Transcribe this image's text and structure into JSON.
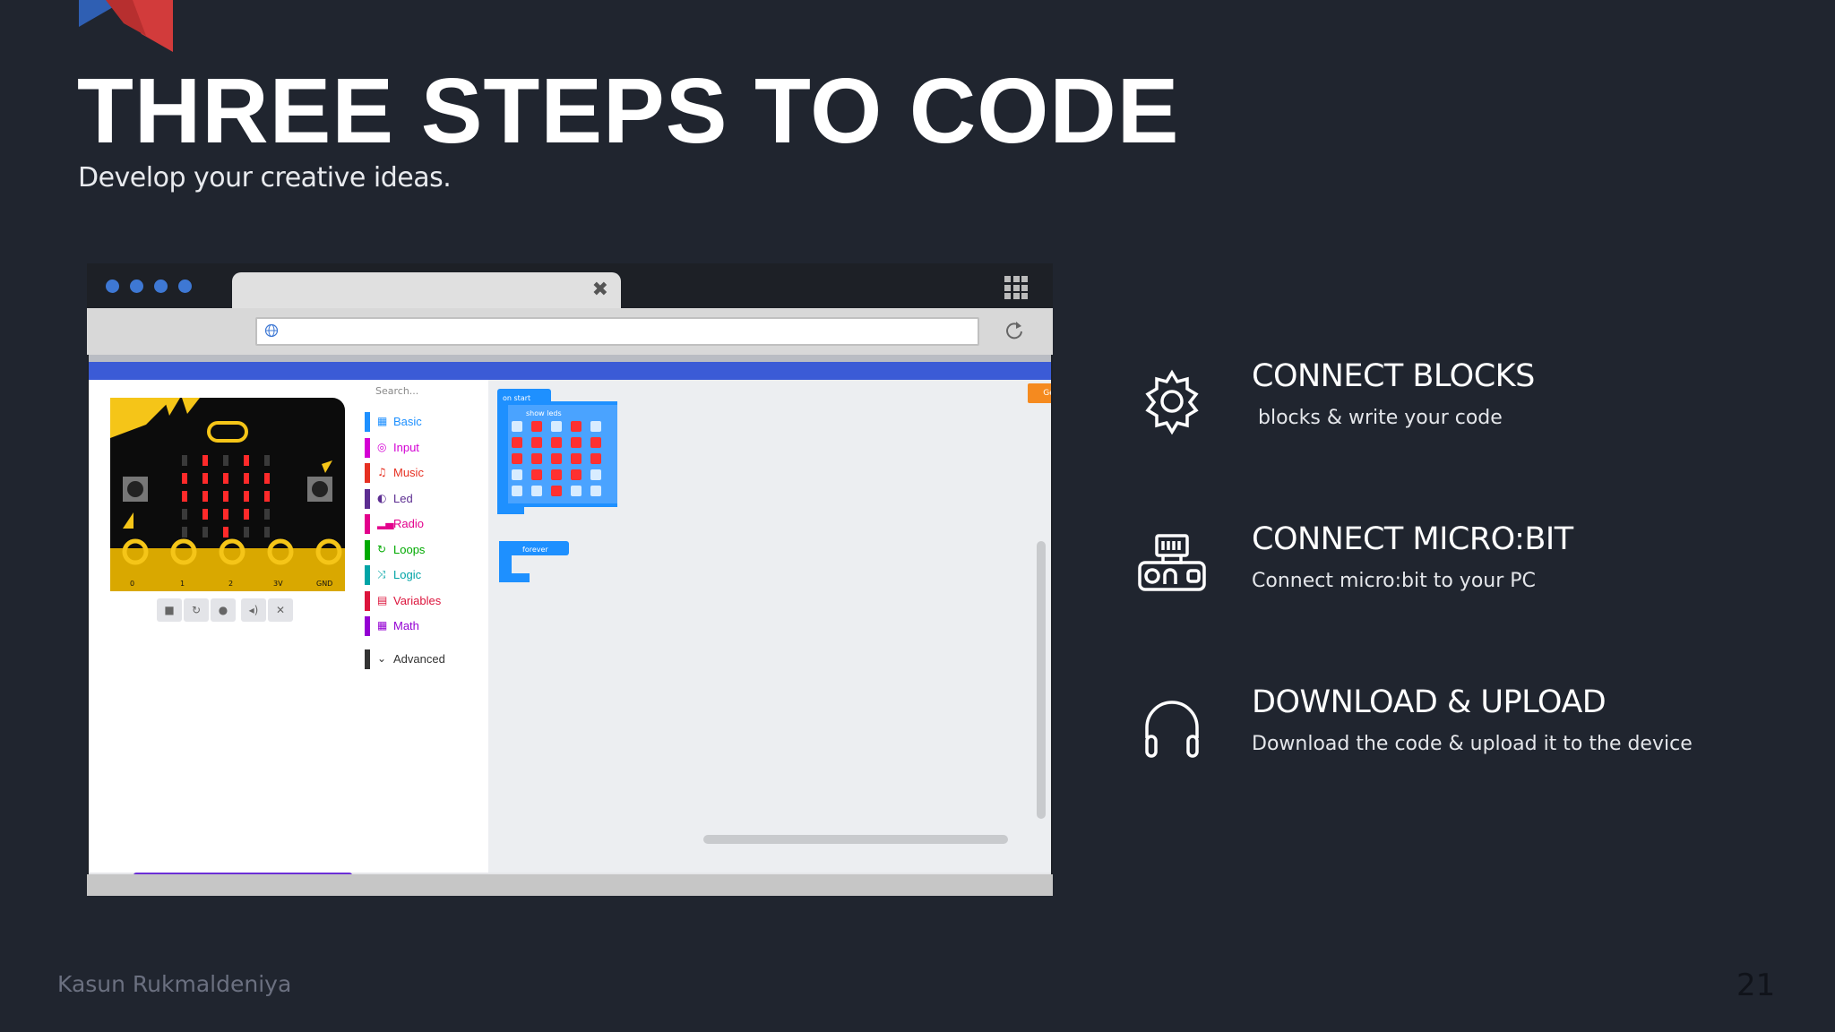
{
  "slide": {
    "title": "THREE STEPS TO CODE",
    "subtitle": "Develop your creative ideas.",
    "footer_author": "Kasun Rukmaldeniya",
    "page_number": "21"
  },
  "browser": {
    "tab_close_icon": "close-icon",
    "apps_icon": "apps-grid-icon",
    "reload_icon": "reload-icon",
    "globe_icon": "globe-icon"
  },
  "makecode": {
    "search_placeholder": "Search...",
    "categories": [
      {
        "label": "Basic",
        "color": "#1e90ff"
      },
      {
        "label": "Input",
        "color": "#d400d4"
      },
      {
        "label": "Music",
        "color": "#e63022"
      },
      {
        "label": "Led",
        "color": "#5c2d91"
      },
      {
        "label": "Radio",
        "color": "#e3008c"
      },
      {
        "label": "Loops",
        "color": "#00aa00"
      },
      {
        "label": "Logic",
        "color": "#00a4a6"
      },
      {
        "label": "Variables",
        "color": "#dc143c"
      },
      {
        "label": "Math",
        "color": "#9400d3"
      },
      {
        "label": "Advanced",
        "color": "#333333"
      }
    ],
    "getting_started": "Getting Started",
    "block_on_start": "on start",
    "block_show_leds": "show leds",
    "block_forever": "forever",
    "pin_labels": [
      "0",
      "1",
      "2",
      "3V",
      "GND"
    ]
  },
  "steps": [
    {
      "icon": "gear-icon",
      "title": "CONNECT BLOCKS",
      "desc": " blocks & write your code"
    },
    {
      "icon": "microbit-device-icon",
      "title": "CONNECT MICRO:BIT",
      "desc": "Connect micro:bit to your PC"
    },
    {
      "icon": "headphones-icon",
      "title": "DOWNLOAD & UPLOAD",
      "desc": "Download the code & upload it to the device"
    }
  ]
}
